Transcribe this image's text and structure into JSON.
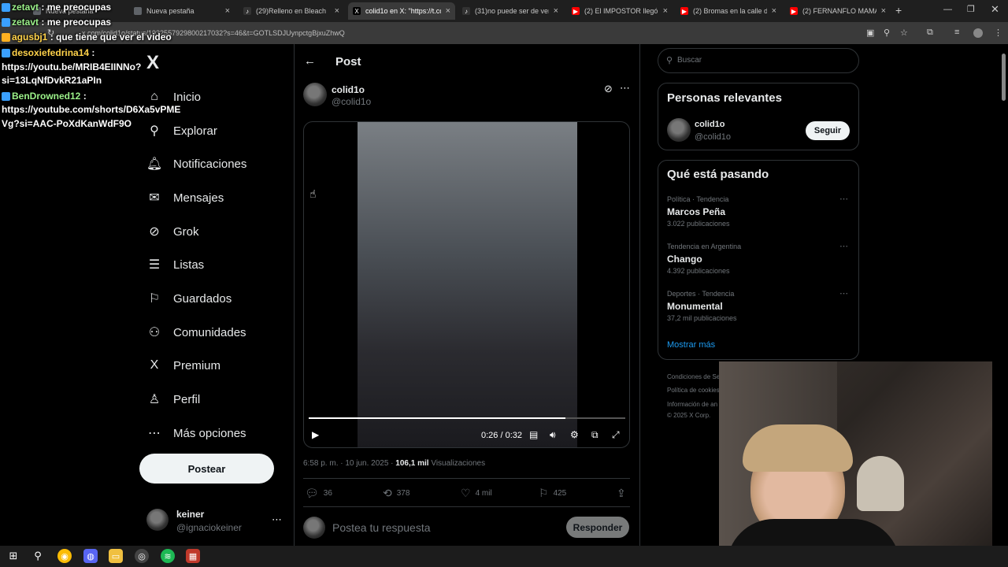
{
  "browser": {
    "tabs": [
      {
        "title": "Nueva pestaña",
        "fav_color": "#5f6368"
      },
      {
        "title": "Nueva pestaña",
        "fav_color": "#5f6368"
      },
      {
        "title": "(29)Relleno en Bleach",
        "fav_color": "#000000"
      },
      {
        "title": "colid1o en X: \"https://t.co",
        "fav_color": "#000000"
      },
      {
        "title": "(31)no puede ser de verd",
        "fav_color": "#000000"
      },
      {
        "title": "(2) El IMPOSTOR llegó m",
        "fav_color": "#ff0000"
      },
      {
        "title": "(2) Bromas en la calle de",
        "fav_color": "#ff0000"
      },
      {
        "title": "(2) FERNANFLO MAMA M",
        "fav_color": "#ff0000"
      }
    ],
    "url": "x.com/colid1o/status/1932557929800217032?s=46&t=GOTLSDJUynpctgBjxuZhwQ"
  },
  "chat": [
    {
      "user": "zetavt",
      "msg": ": me preocupas"
    },
    {
      "user": "zetavt",
      "msg": ": me preocupas"
    },
    {
      "user": "agusbj1",
      "msg": ": que tiene que ver el video"
    },
    {
      "user": "desoxiefedrina14",
      "msg": ":"
    },
    {
      "line": "https://youtu.be/MRIB4EIINNo?"
    },
    {
      "line": "si=13LqNfDvkR21aPIn"
    },
    {
      "user": "BenDrowned12",
      "msg": ":"
    },
    {
      "line": "https://youtube.com/shorts/D6Xa5vPME"
    },
    {
      "line": "Vg?si=AAC-PoXdKanWdF9O"
    }
  ],
  "nav": {
    "logo": "X",
    "items": [
      {
        "label": "Inicio",
        "icon": "home-icon",
        "glyph": "⌂"
      },
      {
        "label": "Explorar",
        "icon": "search-icon",
        "glyph": "⚲"
      },
      {
        "label": "Notificaciones",
        "icon": "bell-icon",
        "glyph": "🔔︎"
      },
      {
        "label": "Mensajes",
        "icon": "mail-icon",
        "glyph": "✉"
      },
      {
        "label": "Grok",
        "icon": "grok-icon",
        "glyph": "⊘"
      },
      {
        "label": "Listas",
        "icon": "list-icon",
        "glyph": "☰"
      },
      {
        "label": "Guardados",
        "icon": "bookmark-icon",
        "glyph": "⚐"
      },
      {
        "label": "Comunidades",
        "icon": "communities-icon",
        "glyph": "⚇"
      },
      {
        "label": "Premium",
        "icon": "premium-x-icon",
        "glyph": "X"
      },
      {
        "label": "Perfil",
        "icon": "profile-icon",
        "glyph": "♙"
      },
      {
        "label": "Más opciones",
        "icon": "more-icon",
        "glyph": "⋯"
      }
    ],
    "post_button": "Postear",
    "account": {
      "name": "keiner",
      "handle": "@ignaciokeiner"
    }
  },
  "post": {
    "header_title": "Post",
    "author": {
      "name": "colid1o",
      "handle": "@colid1o"
    },
    "video": {
      "time": "0:26 / 0:32",
      "progress": 0.81
    },
    "meta": {
      "time": "6:58 p. m. · 10 jun. 2025 · ",
      "views": "106,1 mil",
      "views_label": " Visualizaciones"
    },
    "stats": {
      "replies": "36",
      "reposts": "378",
      "likes": "4 mil",
      "bookmarks": "425"
    },
    "reply_placeholder": "Postea tu respuesta",
    "reply_button": "Responder"
  },
  "sidebar": {
    "search_placeholder": "Buscar",
    "relevant_title": "Personas relevantes",
    "relevant_person": {
      "name": "colid1o",
      "handle": "@colid1o",
      "button": "Seguir"
    },
    "trending_title": "Qué está pasando",
    "trends": [
      {
        "meta": "Política · Tendencia",
        "name": "Marcos Peña",
        "count": "3.022 publicaciones"
      },
      {
        "meta": "Tendencia en Argentina",
        "name": "Chango",
        "count": "4.392 publicaciones"
      },
      {
        "meta": "Deportes · Tendencia",
        "name": "Monumental",
        "count": "37,2 mil publicaciones"
      }
    ],
    "show_more": "Mostrar más",
    "footer": [
      "Condiciones de Ser",
      "Política de cookies",
      "Información de an",
      "© 2025 X Corp."
    ]
  }
}
